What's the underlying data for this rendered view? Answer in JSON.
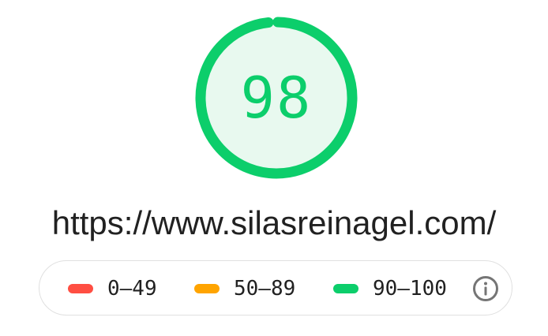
{
  "report": {
    "score": "98",
    "score_fraction": 0.98,
    "url": "https://www.silasreinagel.com/"
  },
  "legend": {
    "items": [
      {
        "label": "0–49",
        "color": "#ff4e42"
      },
      {
        "label": "50–89",
        "color": "#ffa400"
      },
      {
        "label": "90–100",
        "color": "#0cce6b"
      }
    ],
    "info_icon": "info-icon"
  },
  "colors": {
    "pass": "#0cce6b",
    "pass_fill": "#e8f9ef",
    "text": "#212121",
    "icon": "#757575"
  }
}
